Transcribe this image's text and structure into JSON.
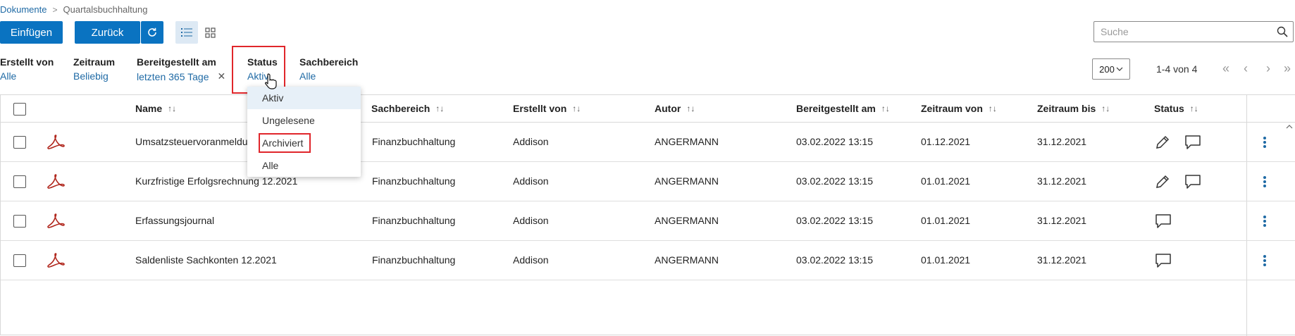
{
  "breadcrumb": {
    "root": "Dokumente",
    "separator": ">",
    "current": "Quartalsbuchhaltung"
  },
  "toolbar": {
    "insert_label": "Einfügen",
    "back_label": "Zurück",
    "icons": [
      "refresh-icon",
      "list-view-icon",
      "grid-view-icon"
    ],
    "search_placeholder": "Suche"
  },
  "filters": [
    {
      "label": "Erstellt von",
      "value": "Alle"
    },
    {
      "label": "Zeitraum",
      "value": "Beliebig"
    },
    {
      "label": "Bereitgestellt am",
      "value": "letzten 365 Tage",
      "clearable": true
    },
    {
      "label": "Status",
      "value": "Aktiv"
    },
    {
      "label": "Sachbereich",
      "value": "Alle"
    }
  ],
  "status_dropdown": {
    "options": [
      "Aktiv",
      "Ungelesene",
      "Archiviert",
      "Alle"
    ],
    "selected": "Aktiv"
  },
  "pager": {
    "page_size": "200",
    "info": "1-4 von 4"
  },
  "table": {
    "columns": [
      "Name",
      "Sachbereich",
      "Erstellt von",
      "Autor",
      "Bereitgestellt am",
      "Zeitraum von",
      "Zeitraum bis",
      "Status"
    ],
    "sort_icon": "↑↓",
    "rows": [
      {
        "name": "Umsatzsteuervoranmeldu",
        "sachbereich": "Finanzbuchhaltung",
        "erstellt_von": "Addison",
        "autor": "ANGERMANN",
        "bereitgestellt": "03.02.2022 13:15",
        "von": "01.12.2021",
        "bis": "31.12.2021",
        "status_icons": [
          "edit-icon",
          "comment-icon"
        ]
      },
      {
        "name": "Kurzfristige Erfolgsrechnung 12.2021",
        "sachbereich": "Finanzbuchhaltung",
        "erstellt_von": "Addison",
        "autor": "ANGERMANN",
        "bereitgestellt": "03.02.2022 13:15",
        "von": "01.01.2021",
        "bis": "31.12.2021",
        "status_icons": [
          "edit-icon",
          "comment-icon"
        ]
      },
      {
        "name": "Erfassungsjournal",
        "sachbereich": "Finanzbuchhaltung",
        "erstellt_von": "Addison",
        "autor": "ANGERMANN",
        "bereitgestellt": "03.02.2022 13:15",
        "von": "01.01.2021",
        "bis": "31.12.2021",
        "status_icons": [
          "comment-icon"
        ]
      },
      {
        "name": "Saldenliste Sachkonten 12.2021",
        "sachbereich": "Finanzbuchhaltung",
        "erstellt_von": "Addison",
        "autor": "ANGERMANN",
        "bereitgestellt": "03.02.2022 13:15",
        "von": "01.01.2021",
        "bis": "31.12.2021",
        "status_icons": [
          "comment-icon"
        ]
      }
    ]
  },
  "colors": {
    "primary": "#0a73c1",
    "link": "#1f6aa5",
    "highlight": "#e0262b",
    "pdf": "#b0261c"
  }
}
